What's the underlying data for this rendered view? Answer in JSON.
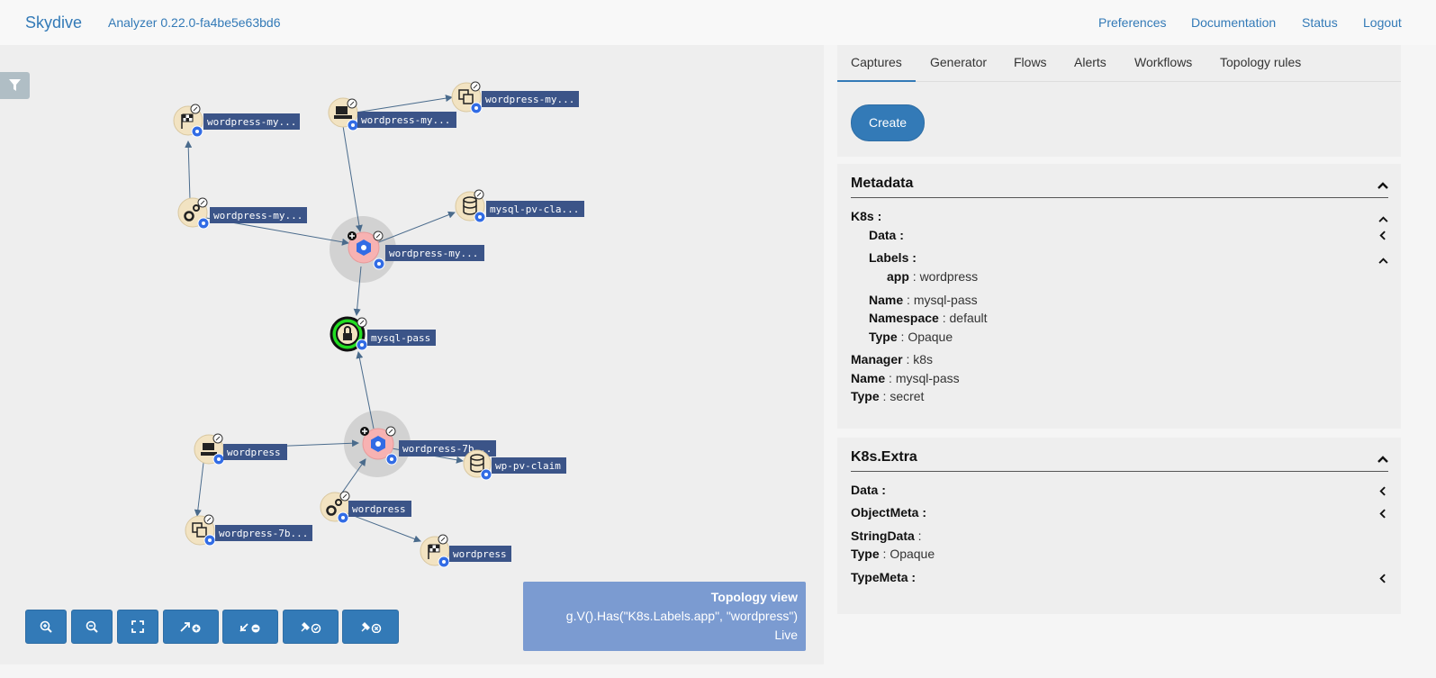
{
  "header": {
    "brand": "Skydive",
    "version": "Analyzer 0.22.0-fa4be5e63bd6",
    "nav": [
      "Preferences",
      "Documentation",
      "Status",
      "Logout"
    ]
  },
  "tabs": [
    "Captures",
    "Generator",
    "Flows",
    "Alerts",
    "Workflows",
    "Topology rules"
  ],
  "active_tab": "Captures",
  "captures": {
    "create_label": "Create"
  },
  "topology": {
    "nodes": [
      {
        "label": "wordpress-my...",
        "icon": "checkered-flag-icon"
      },
      {
        "label": "wordpress-my...",
        "icon": "deployment-icon"
      },
      {
        "label": "wordpress-my...",
        "icon": "copy-icon"
      },
      {
        "label": "wordpress-my...",
        "icon": "gears-icon"
      },
      {
        "label": "mysql-pv-cla...",
        "icon": "database-icon"
      },
      {
        "label": "wordpress-my...",
        "icon": "pod-icon"
      },
      {
        "label": "mysql-pass",
        "icon": "lock-icon"
      },
      {
        "label": "wordpress",
        "icon": "laptop-icon"
      },
      {
        "label": "wordpress-7b...",
        "icon": "pod-icon"
      },
      {
        "label": "wp-pv-claim",
        "icon": "database-icon"
      },
      {
        "label": "wordpress",
        "icon": "gears-icon"
      },
      {
        "label": "wordpress-7b...",
        "icon": "copy-icon"
      },
      {
        "label": "wordpress",
        "icon": "checkered-flag-icon"
      }
    ],
    "view": {
      "title": "Topology view",
      "query": "g.V().Has(\"K8s.Labels.app\", \"wordpress\")",
      "mode": "Live"
    },
    "zoom_buttons": [
      "zoom-in-icon",
      "zoom-out-icon",
      "fit-icon",
      "expand-icon",
      "collapse-icon",
      "pin-icon",
      "unpin-icon"
    ]
  },
  "metadata": {
    "title": "Metadata",
    "k8s_label": "K8s",
    "data_label": "Data",
    "labels_label": "Labels",
    "app_key": "app",
    "app_value": "wordpress",
    "name_key": "Name",
    "name_value": "mysql-pass",
    "namespace_key": "Namespace",
    "namespace_value": "default",
    "type_key": "Type",
    "type_value": "Opaque",
    "manager_key": "Manager",
    "manager_value": "k8s",
    "name2_key": "Name",
    "name2_value": "mysql-pass",
    "type2_key": "Type",
    "type2_value": "secret"
  },
  "k8s_extra": {
    "title": "K8s.Extra",
    "data_label": "Data",
    "objectmeta_label": "ObjectMeta",
    "stringdata_label": "StringData",
    "type_key": "Type",
    "type_value": "Opaque",
    "typemeta_label": "TypeMeta"
  },
  "colors": {
    "accent": "#337ab7",
    "node_label_bg": "#3b5488",
    "pod_fill": "#f7b2b2",
    "selected_ring": "#22dd22",
    "view_box": "#7b9bd1"
  }
}
